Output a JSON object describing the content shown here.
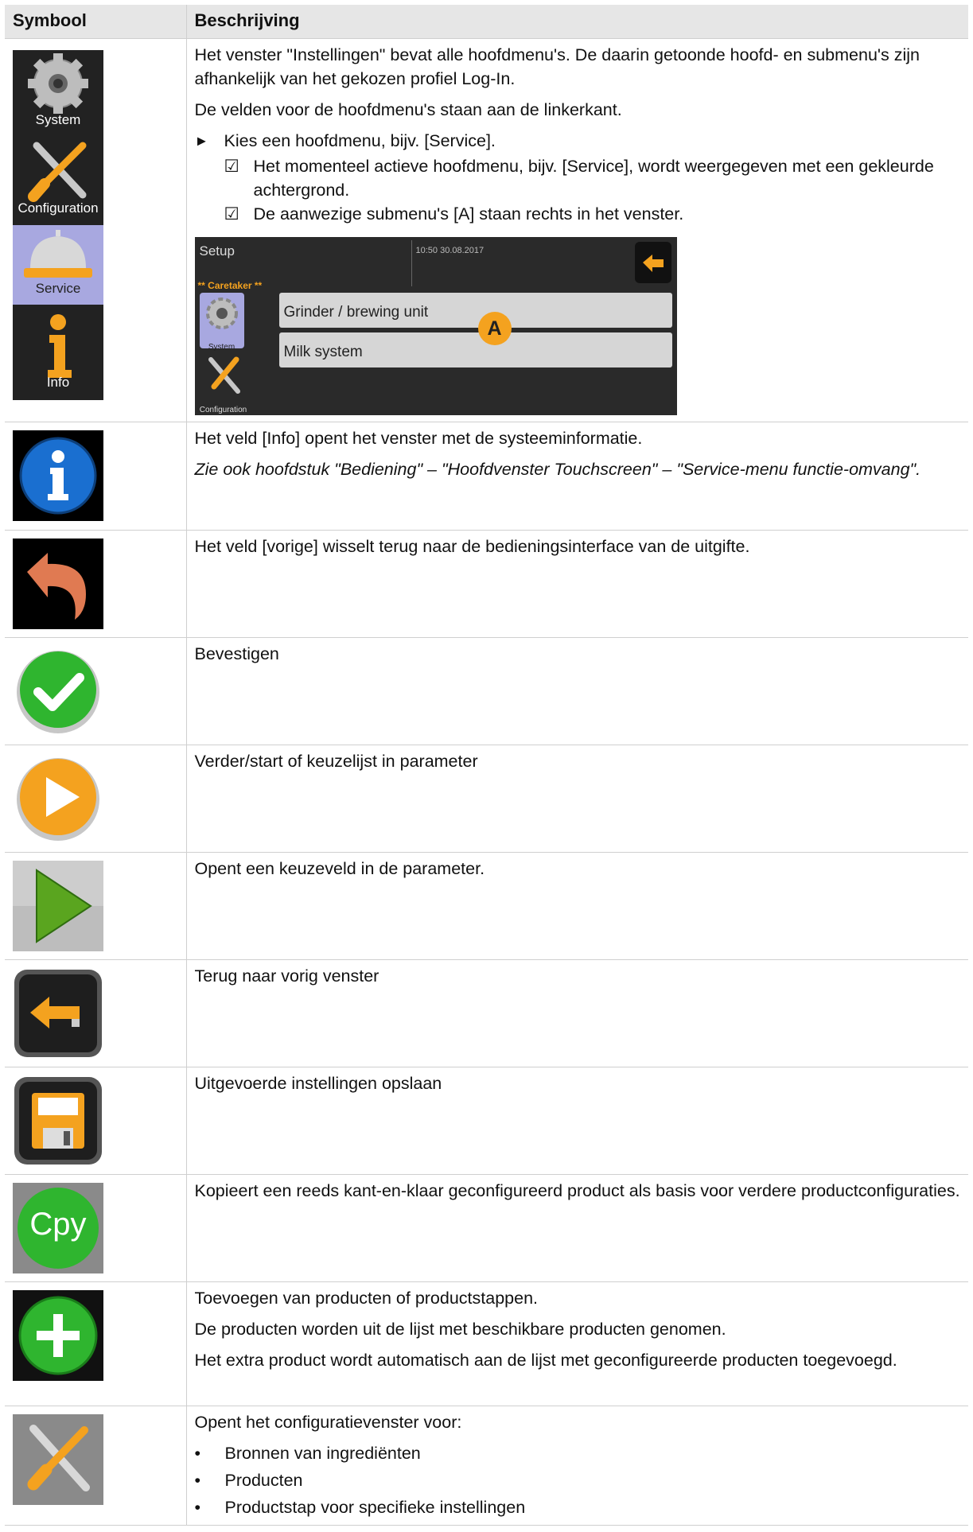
{
  "header": {
    "symbol": "Symbool",
    "description": "Beschrijving"
  },
  "rows": {
    "settings": {
      "menu_labels": {
        "system": "System",
        "configuration": "Configuration",
        "service": "Service",
        "info": "Info"
      },
      "p1": "Het venster \"Instellingen\" bevat alle hoofdmenu's. De daarin getoonde hoofd- en submenu's zijn afhankelijk van het gekozen profiel Log-In.",
      "p2": "De velden voor de hoofdmenu's staan aan de linkerkant.",
      "step_marker": "►",
      "step": "Kies een hoofdmenu, bijv. [Service].",
      "check_marker": "☑",
      "result1": "Het momenteel actieve hoofdmenu, bijv. [Service], wordt weergegeven met een gekleurde achtergrond.",
      "result2": "De aanwezige submenu's [A] staan rechts in het venster.",
      "screen": {
        "title": "Setup",
        "datetime": "10:50 30.08.2017",
        "profile": "** Caretaker **",
        "system": "System",
        "configuration": "Configuration",
        "item1": "Grinder / brewing unit",
        "item2": "Milk system",
        "callout": "A"
      }
    },
    "info": {
      "p1": "Het veld [Info] opent het venster met de systeeminformatie.",
      "p2": "Zie ook hoofdstuk \"Bediening\" – \"Hoofdvenster Touchscreen\" – \"Service-menu functie-omvang\"."
    },
    "previous": {
      "p1": "Het veld [vorige] wisselt terug naar de bedieningsinterface van de uitgifte."
    },
    "confirm": {
      "p1": "Bevestigen"
    },
    "next": {
      "p1": "Verder/start of keuzelijst in parameter"
    },
    "open_field": {
      "p1": "Opent een keuzeveld in de parameter."
    },
    "back": {
      "p1": "Terug naar vorig venster"
    },
    "save": {
      "p1": "Uitgevoerde instellingen opslaan"
    },
    "copy": {
      "icon_text": "Cpy",
      "p1": "Kopieert een reeds kant-en-klaar geconfigureerd product als basis voor verdere productconfiguraties."
    },
    "add": {
      "p1": "Toevoegen van producten of productstappen.",
      "p2": "De producten worden uit de lijst met beschikbare producten genomen.",
      "p3": "Het extra product wordt automatisch aan de lijst met geconfigureerde producten toegevoegd."
    },
    "config": {
      "p1": "Opent het configuratievenster voor:",
      "bullet": "•",
      "items": [
        "Bronnen van ingrediënten",
        "Producten",
        "Productstap voor specifieke instellingen"
      ]
    }
  },
  "colors": {
    "header_bg": "#e6e6e6",
    "active_menu": "#a8a8e0",
    "orange": "#f4a21f",
    "green": "#2fb52f",
    "blue": "#1a6fd0"
  }
}
